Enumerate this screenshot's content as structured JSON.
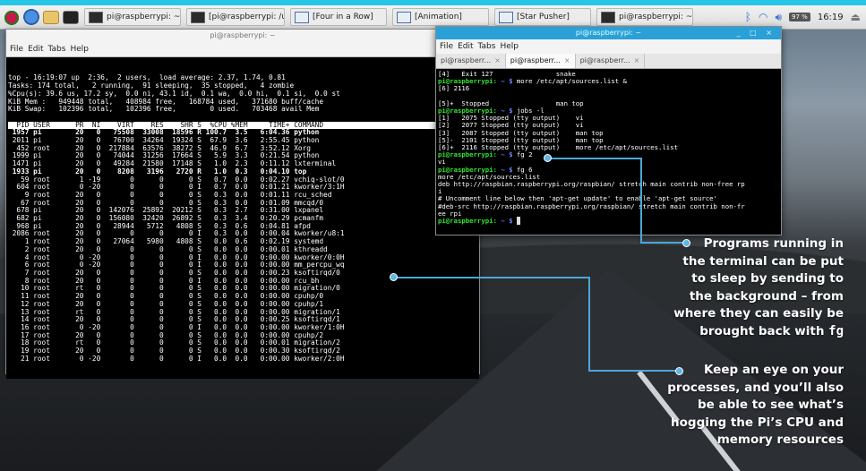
{
  "taskbar": {
    "tasks": [
      {
        "label": "pi@raspberrypi: ~"
      },
      {
        "label": "[pi@raspberrypi: /usr/..."
      },
      {
        "label": "[Four in a Row]"
      },
      {
        "label": "[Animation]"
      },
      {
        "label": "[Star Pusher]"
      },
      {
        "label": "pi@raspberrypi: ~"
      }
    ],
    "battery": "97 %",
    "clock": "16:19"
  },
  "window_main": {
    "title": "pi@raspberrypi: ~",
    "menu": [
      "File",
      "Edit",
      "Tabs",
      "Help"
    ],
    "summary": [
      "top - 16:19:07 up  2:36,  2 users,  load average: 2.37, 1.74, 0.81",
      "Tasks: 174 total,   2 running,  91 sleeping,  35 stopped,   4 zombie",
      "%Cpu(s): 39.6 us, 17.2 sy,  0.0 ni, 43.1 id,  0.1 wa,  0.0 hi,  0.1 si,  0.0 st",
      "KiB Mem :   949448 total,   408984 free,   168784 used,   371680 buff/cache",
      "KiB Swap:   102396 total,   102396 free,        0 used.   703468 avail Mem"
    ],
    "header": "  PID USER      PR  NI    VIRT    RES    SHR S  %CPU %MEM     TIME+ COMMAND                               ",
    "rows": [
      {
        "text": " 1957 pi        20   0   75508  33008  18596 R 100.7  3.5   6:04.36 python",
        "bold": true
      },
      {
        "text": " 2011 pi        20   0   76700  34264  19324 S  67.9  3.6   2:55.45 python",
        "bold": false
      },
      {
        "text": "  452 root      20   0  217884  63576  38272 S  46.9  6.7   3:52.12 Xorg",
        "bold": false
      },
      {
        "text": " 1999 pi        20   0   74044  31256  17664 S   5.9  3.3   0:21.54 python",
        "bold": false
      },
      {
        "text": " 1471 pi        20   0   49284  21580  17148 S   1.0  2.3   0:11.12 lxterminal",
        "bold": false
      },
      {
        "text": " 1933 pi        20   0    8208   3196   2720 R   1.0  0.3   0:04.10 top",
        "bold": true
      },
      {
        "text": "   59 root       1 -19       0      0      0 S   0.7  0.0   0:02.27 vchiq-slot/0",
        "bold": false
      },
      {
        "text": "  604 root       0 -20       0      0      0 I   0.7  0.0   0:01.21 kworker/3:1H",
        "bold": false
      },
      {
        "text": "    9 root      20   0       0      0      0 S   0.3  0.0   0:01.11 rcu_sched",
        "bold": false
      },
      {
        "text": "   67 root      20   0       0      0      0 S   0.3  0.0   0:01.09 mmcqd/0",
        "bold": false
      },
      {
        "text": "  678 pi        20   0  142076  25892  20212 S   0.3  2.7   0:31.00 lxpanel",
        "bold": false
      },
      {
        "text": "  682 pi        20   0  156080  32420  26892 S   0.3  3.4   0:20.29 pcmanfm",
        "bold": false
      },
      {
        "text": "  968 pi        20   0   28944   5712   4808 S   0.3  0.6   0:04.81 afpd",
        "bold": false
      },
      {
        "text": " 2086 root      20   0       0      0      0 I   0.3  0.0   0:00.04 kworker/u8:1",
        "bold": false
      },
      {
        "text": "    1 root      20   0   27064   5980   4808 S   0.0  0.6   0:02.19 systemd",
        "bold": false
      },
      {
        "text": "    2 root      20   0       0      0      0 S   0.0  0.0   0:00.01 kthreadd",
        "bold": false
      },
      {
        "text": "    4 root       0 -20       0      0      0 I   0.0  0.0   0:00.00 kworker/0:0H",
        "bold": false
      },
      {
        "text": "    6 root       0 -20       0      0      0 I   0.0  0.0   0:00.00 mm_percpu_wq",
        "bold": false
      },
      {
        "text": "    7 root      20   0       0      0      0 S   0.0  0.0   0:00.23 ksoftirqd/0",
        "bold": false
      },
      {
        "text": "    8 root      20   0       0      0      0 I   0.0  0.0   0:00.00 rcu_bh",
        "bold": false
      },
      {
        "text": "   10 root      rt   0       0      0      0 S   0.0  0.0   0:00.00 migration/0",
        "bold": false
      },
      {
        "text": "   11 root      20   0       0      0      0 S   0.0  0.0   0:00.00 cpuhp/0",
        "bold": false
      },
      {
        "text": "   12 root      20   0       0      0      0 S   0.0  0.0   0:00.00 cpuhp/1",
        "bold": false
      },
      {
        "text": "   13 root      rt   0       0      0      0 S   0.0  0.0   0:00.00 migration/1",
        "bold": false
      },
      {
        "text": "   14 root      20   0       0      0      0 S   0.0  0.0   0:00.25 ksoftirqd/1",
        "bold": false
      },
      {
        "text": "   16 root       0 -20       0      0      0 I   0.0  0.0   0:00.00 kworker/1:0H",
        "bold": false
      },
      {
        "text": "   17 root      20   0       0      0      0 S   0.0  0.0   0:00.00 cpuhp/2",
        "bold": false
      },
      {
        "text": "   18 root      rt   0       0      0      0 S   0.0  0.0   0:00.01 migration/2",
        "bold": false
      },
      {
        "text": "   19 root      20   0       0      0      0 S   0.0  0.0   0:00.30 ksoftirqd/2",
        "bold": false
      },
      {
        "text": "   21 root       0 -20       0      0      0 I   0.0  0.0   0:00.00 kworker/2:0H",
        "bold": false
      }
    ]
  },
  "window_second": {
    "title": "pi@raspberrypi: ~",
    "menu": [
      "File",
      "Edit",
      "Tabs",
      "Help"
    ],
    "tabs": [
      "pi@raspberr...",
      "pi@raspberr...",
      "pi@raspberr..."
    ],
    "lines": [
      {
        "t": "[4]   Exit 127                snake"
      },
      {
        "p": "pi@raspberrypi:",
        "d": "~ $",
        "c": " more /etc/apt/sources.list &"
      },
      {
        "t": "[6] 2116"
      },
      {
        "t": ""
      },
      {
        "t": "[5]+  Stopped                 man top"
      },
      {
        "p": "pi@raspberrypi:",
        "d": "~ $",
        "c": " jobs -l"
      },
      {
        "t": "[1]   2075 Stopped (tty output)    vi"
      },
      {
        "t": "[2]   2077 Stopped (tty output)    vi"
      },
      {
        "t": "[3]   2087 Stopped (tty output)    man top"
      },
      {
        "t": "[5]-  2101 Stopped (tty output)    man top"
      },
      {
        "t": "[6]+  2116 Stopped (tty output)    more /etc/apt/sources.list"
      },
      {
        "p": "pi@raspberrypi:",
        "d": "~ $",
        "c": " fg 2"
      },
      {
        "t": "vi"
      },
      {
        "p": "pi@raspberrypi:",
        "d": "~ $",
        "c": " fg 6"
      },
      {
        "t": "more /etc/apt/sources.list"
      },
      {
        "t": "deb http://raspbian.raspberrypi.org/raspbian/ stretch main contrib non-free rp"
      },
      {
        "t": "i"
      },
      {
        "t": "# Uncomment line below then 'apt-get update' to enable 'apt-get source'"
      },
      {
        "t": "#deb-src http://raspbian.raspberrypi.org/raspbian/ stretch main contrib non-fr"
      },
      {
        "t": "ee rpi"
      },
      {
        "p": "pi@raspberrypi:",
        "d": "~ $",
        "c": " "
      }
    ]
  },
  "callouts": {
    "first_lines": [
      "Programs running in",
      "the terminal can be put",
      "to sleep by sending to",
      "the background – from",
      "where they can easily be"
    ],
    "first_last_prefix": "brought back with ",
    "first_code": "fg",
    "second_lines": [
      "Keep an eye on your",
      "processes, and you’ll also",
      "be able to see what’s",
      "hogging the Pi’s CPU and",
      "memory resources"
    ]
  }
}
